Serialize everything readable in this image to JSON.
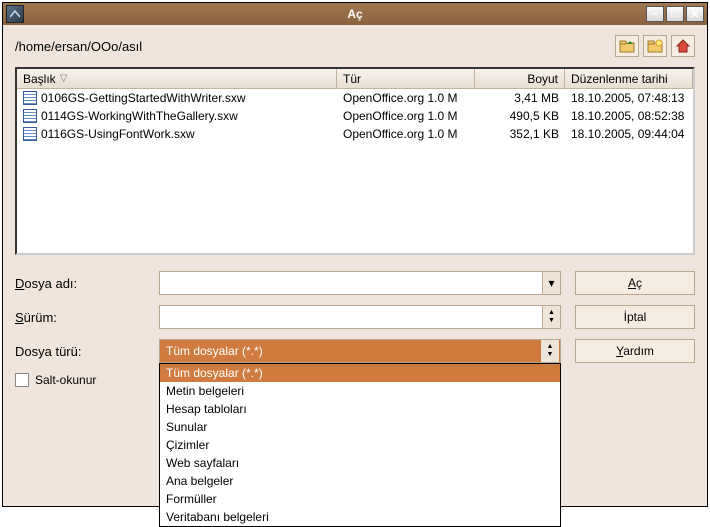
{
  "title": "Aç",
  "path": "/home/ersan/OOo/asıl",
  "toolbar": {
    "up_icon": "folder-up-icon",
    "new_icon": "folder-new-icon",
    "home_icon": "home-icon"
  },
  "columns": {
    "title": "Başlık",
    "type": "Tür",
    "size": "Boyut",
    "date": "Düzenlenme tarihi"
  },
  "files": [
    {
      "name": "0106GS-GettingStartedWithWriter.sxw",
      "type": "OpenOffice.org 1.0 M",
      "size": "3,41 MB",
      "date": "18.10.2005, 07:48:13"
    },
    {
      "name": "0114GS-WorkingWithTheGallery.sxw",
      "type": "OpenOffice.org 1.0 M",
      "size": "490,5 KB",
      "date": "18.10.2005, 08:52:38"
    },
    {
      "name": "0116GS-UsingFontWork.sxw",
      "type": "OpenOffice.org 1.0 M",
      "size": "352,1 KB",
      "date": "18.10.2005, 09:44:04"
    }
  ],
  "labels": {
    "filename": "Dosya adı:",
    "filename_ul": "D",
    "version": "Sürüm:",
    "version_ul": "S",
    "filetype": "Dosya türü:",
    "readonly": "Salt-okunur"
  },
  "filetype_selected": "Tüm dosyalar (*.*)",
  "filetype_options": [
    "Tüm dosyalar (*.*)",
    "Metin belgeleri",
    "Hesap tabloları",
    "Sunular",
    "Çizimler",
    "Web sayfaları",
    "Ana belgeler",
    "Formüller",
    "Veritabanı belgeleri"
  ],
  "buttons": {
    "open": "Aç",
    "open_ul": "A",
    "cancel": "İptal",
    "help": "Yardım",
    "help_ul": "Y"
  },
  "window_controls": {
    "minimize": "–",
    "maximize": "□",
    "close": "✕"
  }
}
